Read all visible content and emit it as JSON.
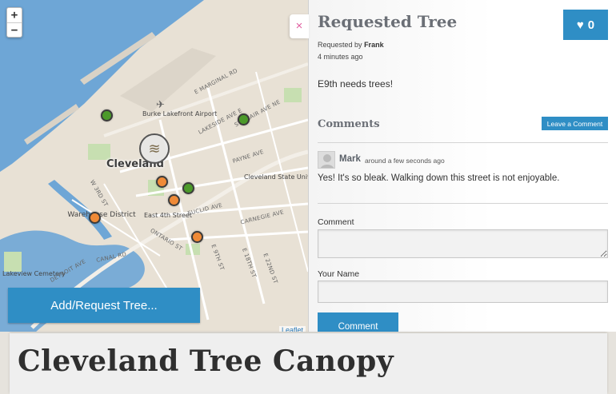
{
  "map": {
    "zoom_in": "+",
    "zoom_out": "−",
    "city": "Cleveland",
    "areas": [
      "Burke Lakefront Airport",
      "Cleveland State University",
      "Lakeview Cemetery",
      "Warehouse District",
      "East 4th Street"
    ],
    "streets": [
      "E MARGINAL RD",
      "LAKESIDE AVE E",
      "ST CLAIR AVE NE",
      "PAYNE AVE",
      "EUCLID AVE",
      "CARNEGIE AVE",
      "ONTARIO ST",
      "CANAL RD",
      "DETROIT AVE",
      "E 9TH ST",
      "E 18TH ST",
      "E 22ND ST",
      "W 3RD ST"
    ],
    "add_button": "Add/Request Tree...",
    "attribution": "Leaflet"
  },
  "panel": {
    "close": "×",
    "title": "Requested Tree",
    "requested_by_prefix": "Requested by",
    "requested_by": "Frank",
    "time": "4 minutes ago",
    "likes": "0",
    "description": "E9th needs trees!",
    "comments_title": "Comments",
    "leave_comment": "Leave a Comment",
    "comment": {
      "author": "Mark",
      "time": "around a few seconds ago",
      "text": "Yes! It's so bleak. Walking down this street is not enjoyable."
    },
    "form": {
      "comment_label": "Comment",
      "name_label": "Your Name",
      "submit": "Comment"
    }
  },
  "banner": {
    "title": "Cleveland Tree Canopy"
  },
  "colors": {
    "accent": "#2f8ec5",
    "water": "#6ea6d6",
    "green_marker": "#4c9a2a",
    "orange_marker": "#ef8a37"
  }
}
